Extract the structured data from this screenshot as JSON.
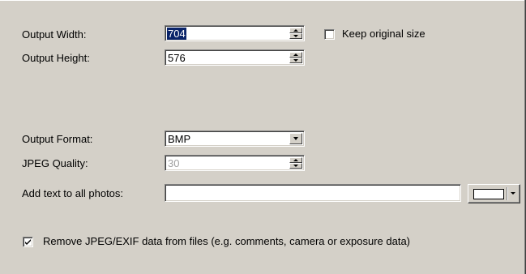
{
  "output_width": {
    "label": "Output Width:",
    "value": "704"
  },
  "output_height": {
    "label": "Output Height:",
    "value": "576"
  },
  "keep_original_size": {
    "label": "Keep original size",
    "checked": false
  },
  "output_format": {
    "label": "Output Format:",
    "selected": "BMP"
  },
  "jpeg_quality": {
    "label": "JPEG Quality:",
    "value": "30",
    "enabled": false
  },
  "add_text": {
    "label": "Add text to all photos:",
    "value": "",
    "color": "#ffffff"
  },
  "remove_exif": {
    "label": "Remove JPEG/EXIF data from files (e.g. comments, camera or exposure data)",
    "checked": true
  },
  "colors": {
    "panel_bg": "#d4d0c8",
    "selection_bg": "#0a246a",
    "disabled_text": "#a0a0a0"
  }
}
